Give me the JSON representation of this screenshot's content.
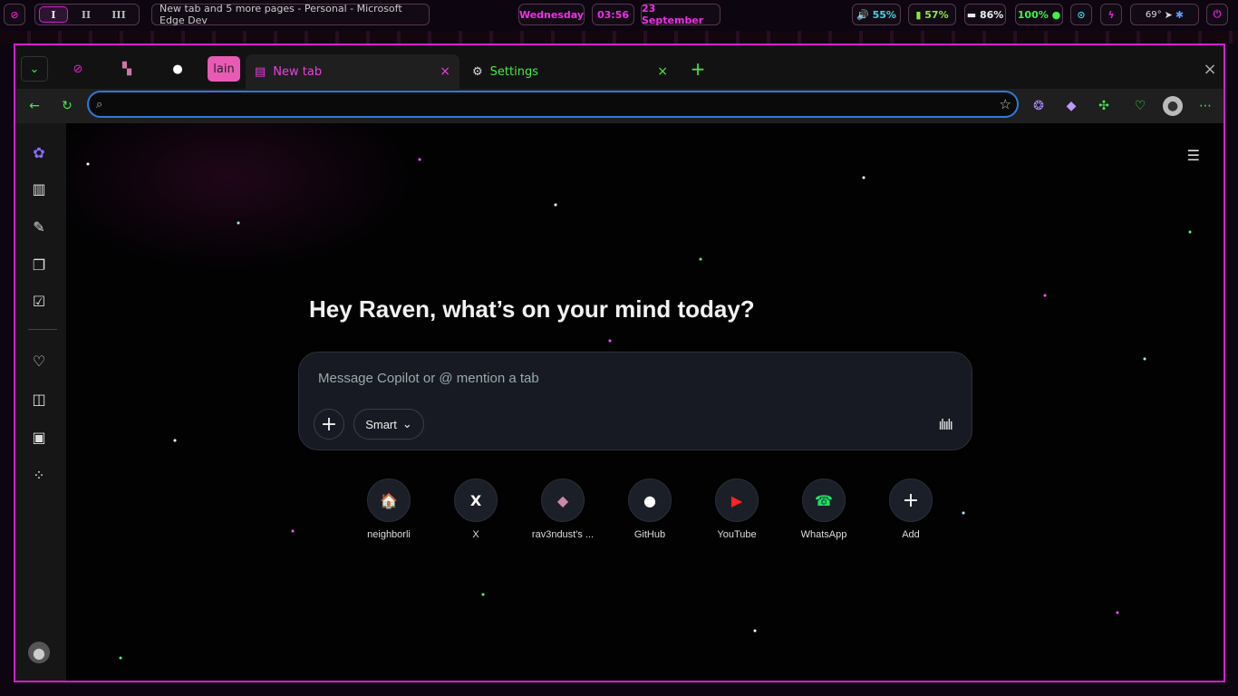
{
  "topbar": {
    "workspaces": [
      "I",
      "II",
      "III"
    ],
    "active_workspace": "I",
    "window_title": "New tab and 5 more pages - Personal - Microsoft Edge Dev",
    "day": "Wednesday",
    "time": "03:56",
    "date": "23 September",
    "volume": "55%",
    "wifi": "57%",
    "battery": "86%",
    "brightness": "100%",
    "temperature": "69°",
    "icons": [
      "arch-icon",
      "speaker-icon",
      "wifi-icon",
      "battery-icon",
      "bluetooth-icon",
      "telegram-icon",
      "power-icon"
    ]
  },
  "tabs": {
    "pinned_label": "lain",
    "active": {
      "label": "New tab",
      "close": "×"
    },
    "second": {
      "label": "Settings",
      "close": "×"
    },
    "new_tab": "+",
    "window_close": "×"
  },
  "address": {
    "value": "",
    "placeholder": ""
  },
  "greeting": "Hey Raven, what’s on your mind today?",
  "composer": {
    "placeholder": "Message Copilot or @ mention a tab",
    "mode": "Smart",
    "plus": "+"
  },
  "shortcuts": [
    {
      "label": "neighborli",
      "glyph": "🏠"
    },
    {
      "label": "X",
      "glyph": "X"
    },
    {
      "label": "rav3ndust's ...",
      "glyph": "◆"
    },
    {
      "label": "GitHub",
      "glyph": "●"
    },
    {
      "label": "YouTube",
      "glyph": "▶"
    },
    {
      "label": "WhatsApp",
      "glyph": "☎"
    },
    {
      "label": "Add",
      "glyph": "+"
    }
  ],
  "colors": {
    "accent": "#d51dd2",
    "green": "#49e84b",
    "url_border": "#2c7bd9"
  }
}
